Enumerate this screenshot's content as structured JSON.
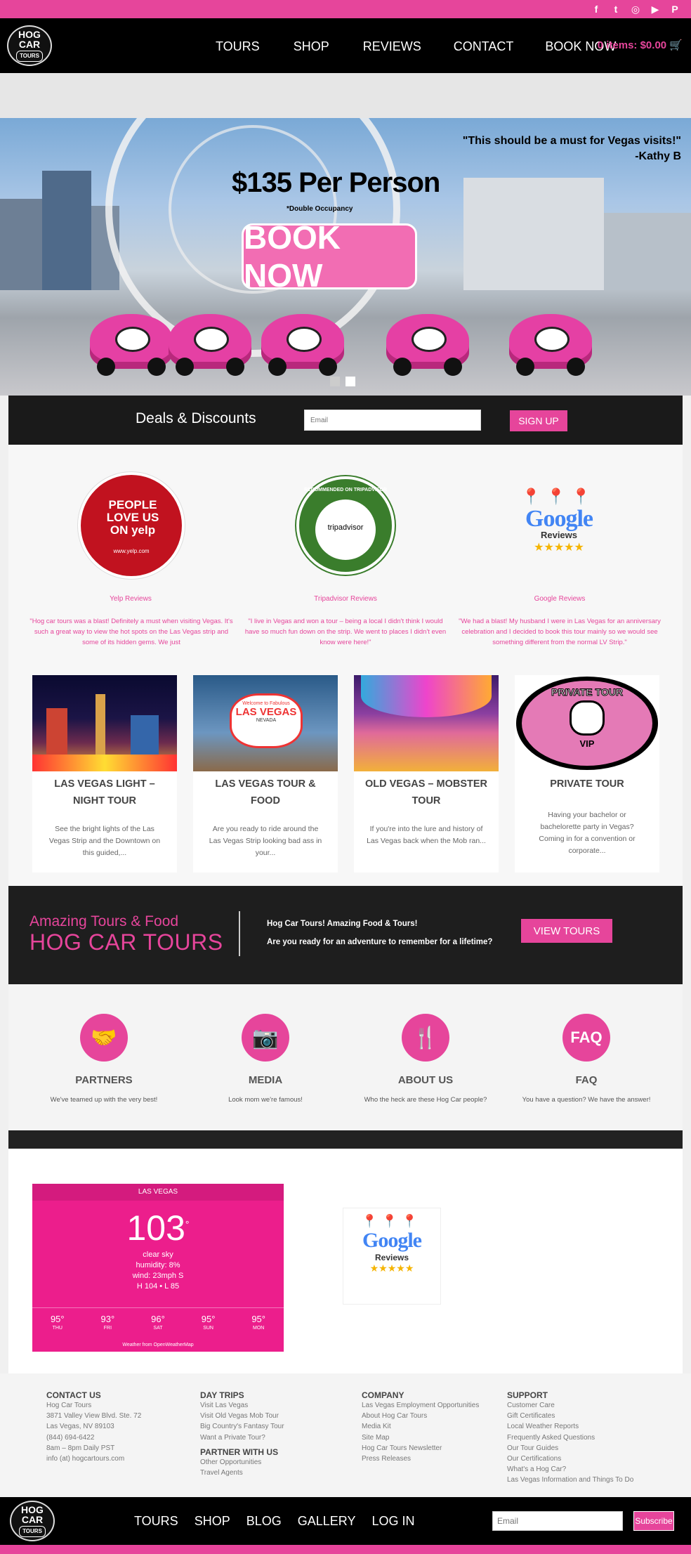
{
  "brand": {
    "logo_line1": "HOG CAR",
    "logo_line2": "TOURS",
    "accent": "#e6459b",
    "dark": "#1a1a1a"
  },
  "social": [
    "facebook-icon",
    "twitter-icon",
    "instagram-icon",
    "youtube-icon",
    "pinterest-icon"
  ],
  "nav": {
    "items": [
      "TOURS",
      "SHOP",
      "REVIEWS",
      "CONTACT",
      "BOOK NOW"
    ],
    "cart": "0 items: $0.00"
  },
  "hero": {
    "price": "$135 Per Person",
    "occupancy": "*Double Occupancy",
    "cta": "BOOK NOW",
    "quote": "\"This should be a must for Vegas visits!\"",
    "quote_author": "-Kathy B"
  },
  "deals": {
    "title": "Deals & Discounts",
    "email_placeholder": "Email",
    "button": "SIGN UP"
  },
  "reviews": [
    {
      "logo": "PEOPLE LOVE US ON yelp",
      "logo_sub": "www.yelp.com",
      "name": "Yelp Reviews",
      "quote": "\"Hog car tours was a blast! Definitely a must when visiting Vegas. It's such a great way to view the hot spots on the Las Vegas strip and some of its hidden gems. We just"
    },
    {
      "logo": "RECOMMENDED ON TRIPADVISOR",
      "logo_sub": "tripadvisor",
      "name": "Tripadvisor Reviews",
      "quote": "\"I live in Vegas and won a tour – being a local I didn't think I would have so much fun down on the strip. We went to places I didn't even know were here!\""
    },
    {
      "logo": "Google",
      "logo_sub": "Reviews",
      "name": "Google Reviews",
      "quote": "\"We had a blast! My husband I were in Las Vegas for an anniversary celebration and I decided to book this tour mainly so we would see something different from the normal LV Strip.\""
    }
  ],
  "tours": [
    {
      "title": "LAS VEGAS LIGHT – NIGHT TOUR",
      "desc": "See the bright lights of the Las Vegas Strip and the Downtown on this guided,..."
    },
    {
      "title": "LAS VEGAS TOUR & FOOD",
      "desc": "Are you ready to ride around the Las Vegas Strip looking bad ass in your..."
    },
    {
      "title": "OLD VEGAS – MOBSTER TOUR",
      "desc": "If you're into the lure and history of Las Vegas back when the Mob ran..."
    },
    {
      "title": "PRIVATE TOUR",
      "desc": "Having your bachelor or bachelorette party in Vegas? Coming in for a convention or corporate..."
    }
  ],
  "tour_images": {
    "sign_top": "Welcome to Fabulous",
    "sign_main": "LAS VEGAS",
    "sign_sub": "NEVADA",
    "private_top": "PRIVATE TOUR",
    "private_bottom": "VIP"
  },
  "promo": {
    "line1": "Amazing Tours & Food",
    "line2": "HOG CAR TOURS",
    "text1": "Hog Car Tours! Amazing Food & Tours!",
    "text2": "Are you ready for an adventure to remember for a lifetime?",
    "button": "VIEW TOURS"
  },
  "features": [
    {
      "icon": "handshake-icon",
      "title": "PARTNERS",
      "desc": "We've teamed up with the very best!"
    },
    {
      "icon": "camera-icon",
      "title": "MEDIA",
      "desc": "Look mom we're famous!"
    },
    {
      "icon": "utensils-icon",
      "title": "ABOUT US",
      "desc": "Who the heck are these Hog Car people?"
    },
    {
      "icon": "faq-icon",
      "title": "FAQ",
      "desc": "You have a question? We have the answer!"
    }
  ],
  "weather": {
    "city": "LAS VEGAS",
    "temp": "103",
    "degree": "°",
    "condition": "clear sky",
    "humidity": "humidity: 8%",
    "wind": "wind: 23mph S",
    "hilo": "H 104 • L 85",
    "forecast": [
      {
        "temp": "95°",
        "day": "THU"
      },
      {
        "temp": "93°",
        "day": "FRI"
      },
      {
        "temp": "96°",
        "day": "SAT"
      },
      {
        "temp": "95°",
        "day": "SUN"
      },
      {
        "temp": "95°",
        "day": "MON"
      }
    ],
    "source": "Weather from OpenWeatherMap"
  },
  "google_badge": {
    "word": "Google",
    "sub": "Reviews",
    "stars": "★★★★★"
  },
  "footer": {
    "contact": {
      "heading": "CONTACT US",
      "lines": [
        "Hog Car Tours",
        "3871 Valley View Blvd. Ste. 72",
        "Las Vegas, NV 89103",
        "(844) 694-6422",
        "8am – 8pm Daily PST",
        "info (at) hogcartours.com"
      ]
    },
    "daytrips": {
      "heading": "DAY TRIPS",
      "lines": [
        "Visit Las Vegas",
        "Visit Old Vegas Mob Tour",
        "Big Country's Fantasy Tour",
        "Want a Private Tour?"
      ]
    },
    "partner": {
      "heading": "PARTNER WITH US",
      "lines": [
        "Other Opportunities",
        "Travel Agents"
      ]
    },
    "company": {
      "heading": "COMPANY",
      "lines": [
        "Las Vegas Employment Opportunities",
        "About Hog Car Tours",
        "Media Kit",
        "Site Map",
        "Hog Car Tours Newsletter",
        "Press Releases"
      ]
    },
    "support": {
      "heading": "SUPPORT",
      "lines": [
        "Customer Care",
        "Gift Certificates",
        "Local Weather Reports",
        "Frequently Asked Questions",
        "Our Tour Guides",
        "Our Certifications",
        "What's a Hog Car?",
        "Las Vegas Information and Things To Do"
      ]
    }
  },
  "bottom_nav": {
    "items": [
      "TOURS",
      "SHOP",
      "BLOG",
      "GALLERY",
      "LOG IN"
    ],
    "email_placeholder": "Email",
    "button": "Subscribe"
  }
}
